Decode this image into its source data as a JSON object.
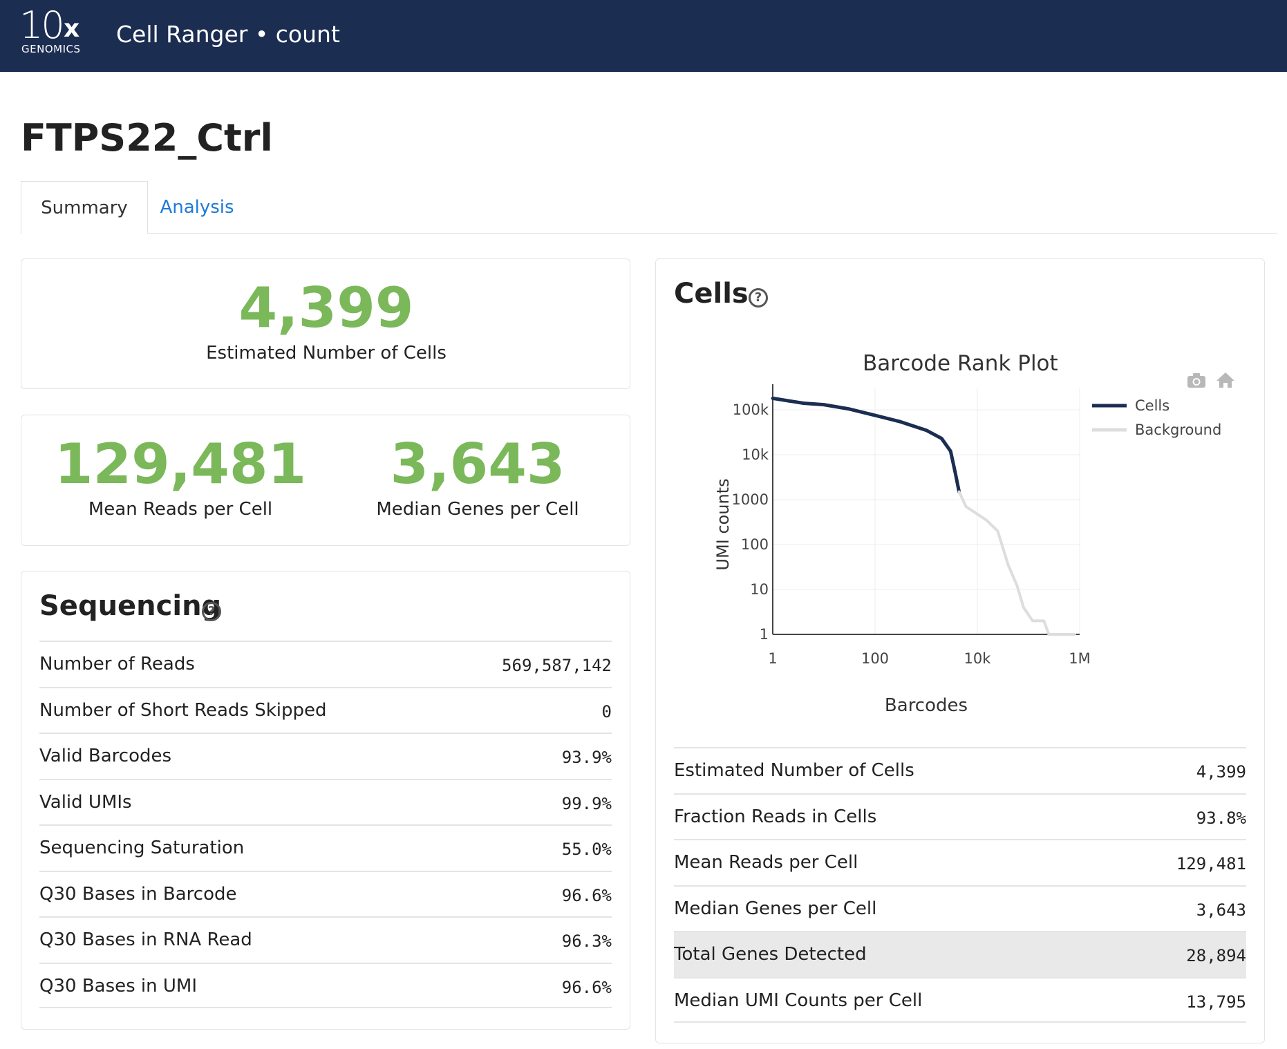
{
  "header": {
    "logo_main": "10",
    "logo_x": "x",
    "logo_sub": "GENOMICS",
    "app_title": "Cell Ranger • count"
  },
  "page": {
    "title": "FTPS22_Ctrl"
  },
  "tabs": [
    {
      "label": "Summary",
      "active": true
    },
    {
      "label": "Analysis",
      "active": false
    }
  ],
  "highlights": {
    "estimated_cells": {
      "value": "4,399",
      "label": "Estimated Number of Cells"
    },
    "mean_reads": {
      "value": "129,481",
      "label": "Mean Reads per Cell"
    },
    "median_genes": {
      "value": "3,643",
      "label": "Median Genes per Cell"
    }
  },
  "sequencing": {
    "title": "Sequencing",
    "help_icon": "?",
    "rows": [
      {
        "label": "Number of Reads",
        "value": "569,587,142"
      },
      {
        "label": "Number of Short Reads Skipped",
        "value": "0"
      },
      {
        "label": "Valid Barcodes",
        "value": "93.9%"
      },
      {
        "label": "Valid UMIs",
        "value": "99.9%"
      },
      {
        "label": "Sequencing Saturation",
        "value": "55.0%"
      },
      {
        "label": "Q30 Bases in Barcode",
        "value": "96.6%"
      },
      {
        "label": "Q30 Bases in RNA Read",
        "value": "96.3%"
      },
      {
        "label": "Q30 Bases in UMI",
        "value": "96.6%"
      }
    ]
  },
  "cells": {
    "title": "Cells",
    "help_icon": "?",
    "plot_tools": {
      "camera": "camera-icon",
      "home": "home-icon"
    },
    "rows": [
      {
        "label": "Estimated Number of Cells",
        "value": "4,399",
        "highlighted": false
      },
      {
        "label": "Fraction Reads in Cells",
        "value": "93.8%",
        "highlighted": false
      },
      {
        "label": "Mean Reads per Cell",
        "value": "129,481",
        "highlighted": false
      },
      {
        "label": "Median Genes per Cell",
        "value": "3,643",
        "highlighted": false
      },
      {
        "label": "Total Genes Detected",
        "value": "28,894",
        "highlighted": true
      },
      {
        "label": "Median UMI Counts per Cell",
        "value": "13,795",
        "highlighted": false
      }
    ]
  },
  "chart_data": {
    "type": "line",
    "title": "Barcode Rank Plot",
    "xlabel": "Barcodes",
    "ylabel": "UMI counts",
    "x_scale": "log",
    "y_scale": "log",
    "xlim": [
      1,
      1000000
    ],
    "ylim": [
      1,
      300000
    ],
    "x_ticks": [
      {
        "value": 1,
        "label": "1"
      },
      {
        "value": 100,
        "label": "100"
      },
      {
        "value": 10000,
        "label": "10k"
      },
      {
        "value": 1000000,
        "label": "1M"
      }
    ],
    "y_ticks": [
      {
        "value": 1,
        "label": "1"
      },
      {
        "value": 10,
        "label": "10"
      },
      {
        "value": 100,
        "label": "100"
      },
      {
        "value": 1000,
        "label": "1000"
      },
      {
        "value": 10000,
        "label": "10k"
      },
      {
        "value": 100000,
        "label": "100k"
      }
    ],
    "grid": true,
    "legend_position": "top-right",
    "series": [
      {
        "name": "Cells",
        "color": "#1c2d52",
        "points": [
          [
            1,
            180000
          ],
          [
            4,
            140000
          ],
          [
            10,
            130000
          ],
          [
            30,
            105000
          ],
          [
            100,
            75000
          ],
          [
            300,
            55000
          ],
          [
            1000,
            35000
          ],
          [
            2000,
            23000
          ],
          [
            3000,
            12000
          ],
          [
            3700,
            4000
          ],
          [
            4399,
            1500
          ]
        ]
      },
      {
        "name": "Background",
        "color": "#dddddd",
        "points": [
          [
            4399,
            1500
          ],
          [
            6000,
            700
          ],
          [
            15000,
            350
          ],
          [
            25000,
            200
          ],
          [
            40000,
            35
          ],
          [
            60000,
            12
          ],
          [
            80000,
            4
          ],
          [
            120000,
            2
          ],
          [
            200000,
            2
          ],
          [
            250000,
            1
          ],
          [
            800000,
            1
          ]
        ]
      }
    ]
  }
}
